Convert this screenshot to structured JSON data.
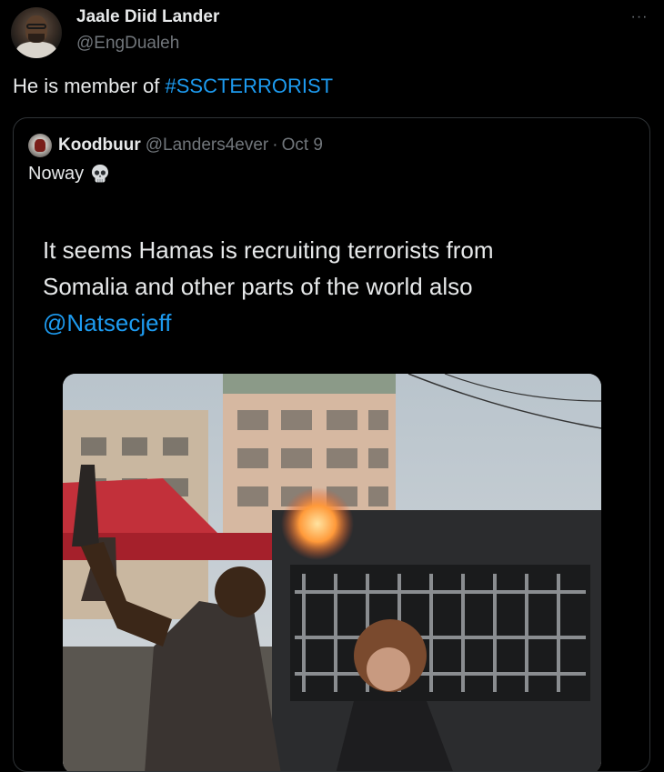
{
  "tweet": {
    "author": {
      "display_name": "Jaale Diid Lander",
      "handle": "@EngDualeh"
    },
    "more_label": "···",
    "text_prefix": "He is member of ",
    "hashtag": "#SSCTERRORIST"
  },
  "quote": {
    "author": {
      "display_name": "Koodbuur",
      "handle": "@Landers4ever",
      "separator": "·",
      "date": "Oct 9"
    },
    "text": "Noway",
    "emoji_icon": "skull-icon",
    "media": {
      "caption_lines": [
        "It seems Hamas is recruiting terrorists from",
        "Somalia and other parts of the world also"
      ],
      "mention": "@Natsecjeff"
    }
  },
  "colors": {
    "background": "#000000",
    "text": "#e7e9ea",
    "secondary_text": "#71767b",
    "link": "#1d9bf0",
    "border": "#2f3336"
  }
}
